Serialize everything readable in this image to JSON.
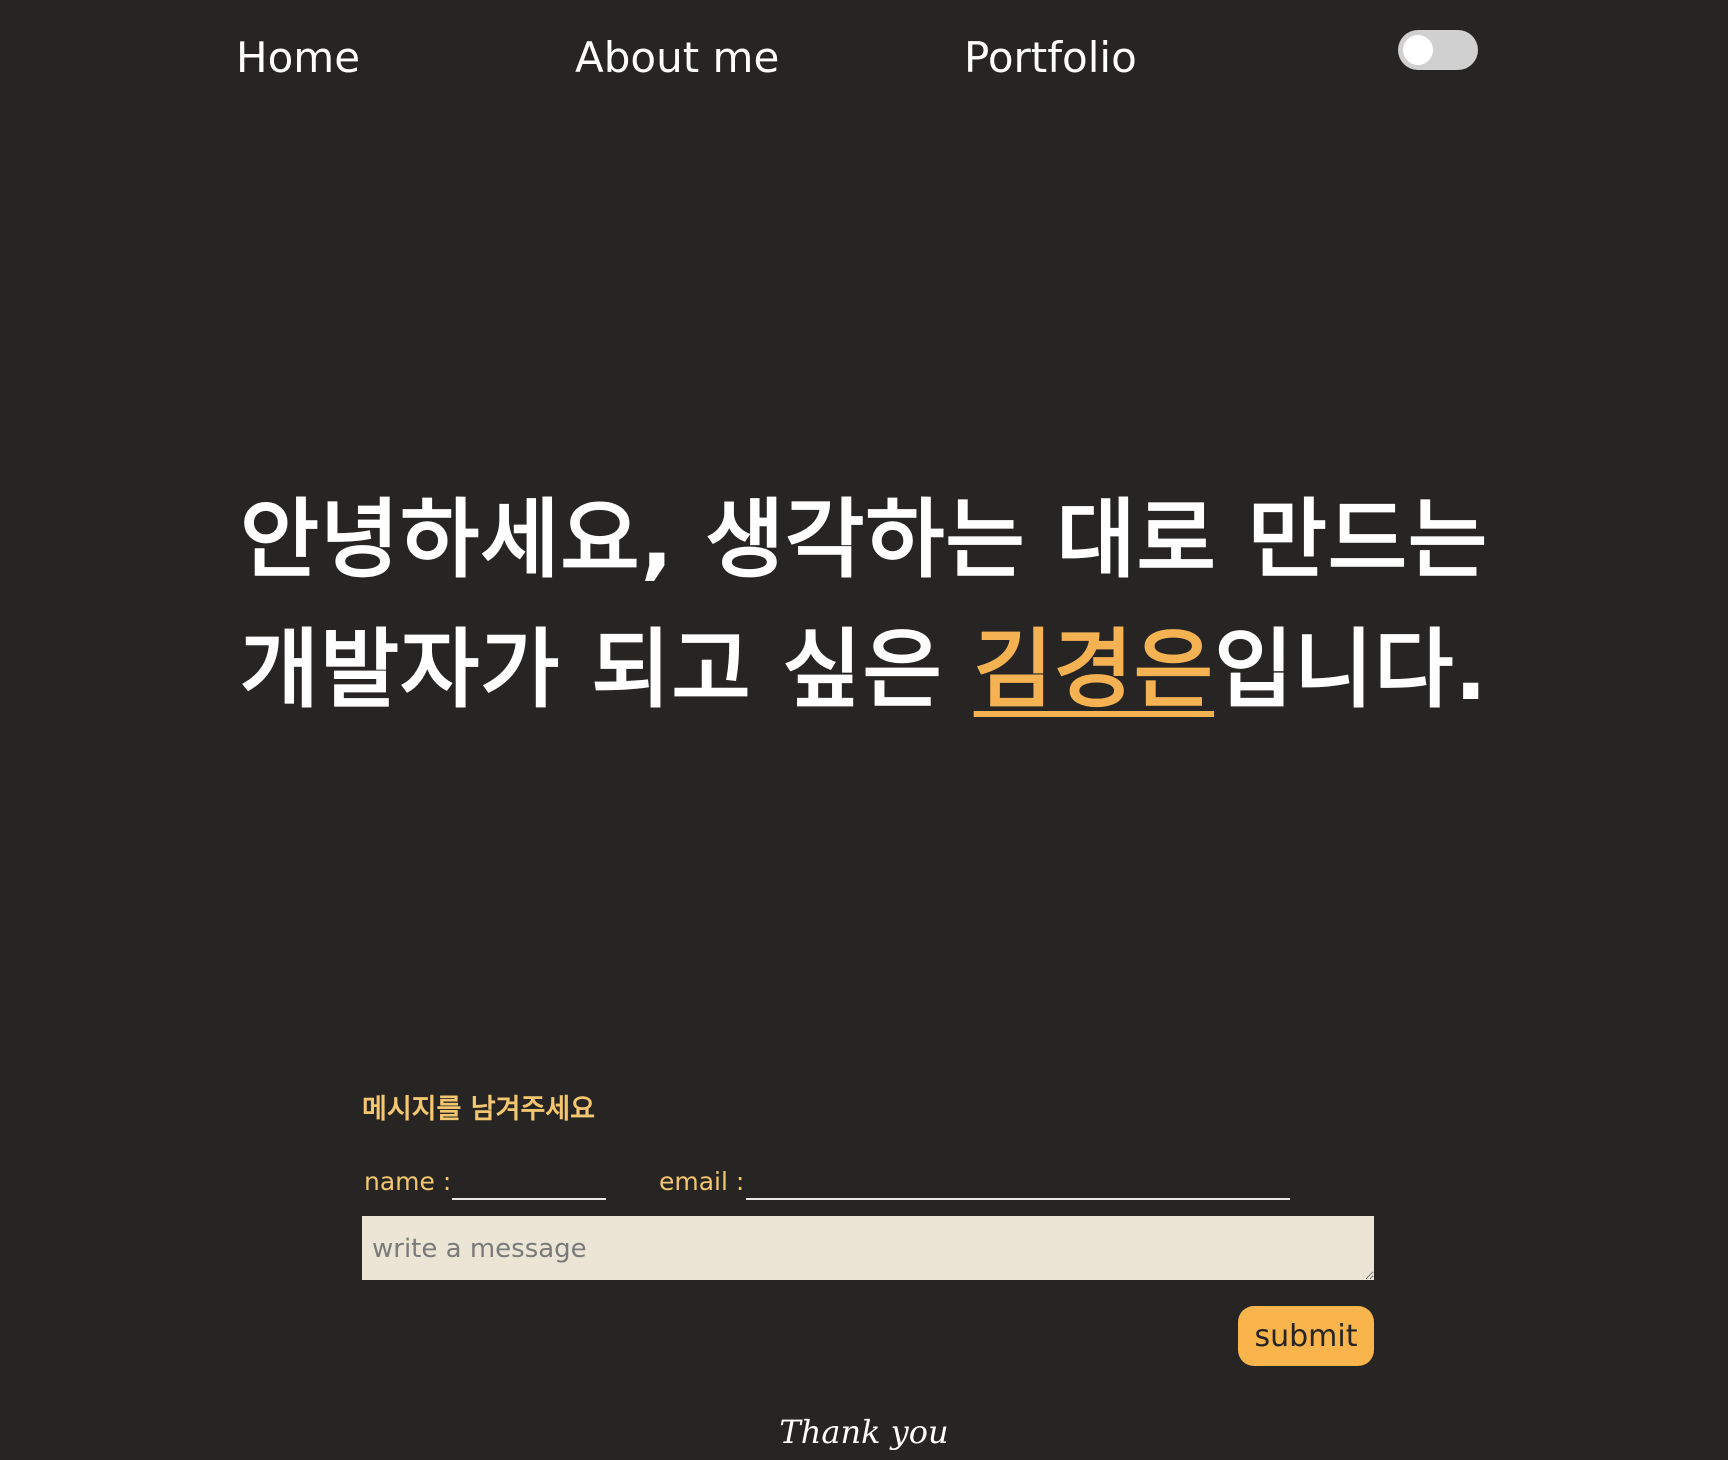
{
  "nav": {
    "items": [
      {
        "label": "Home"
      },
      {
        "label": "About me"
      },
      {
        "label": "Portfolio"
      }
    ],
    "theme_toggle": {
      "state": "off"
    }
  },
  "hero": {
    "line1": "안녕하세요, 생각하는 대로 만드는",
    "line2_before": "개발자가 되고 싶은 ",
    "name": "김경은",
    "line2_after": "입니다."
  },
  "contact": {
    "title": "메시지를 남겨주세요",
    "name_label": "name :",
    "name_value": "",
    "email_label": "email :",
    "email_value": "",
    "message_placeholder": "write a message",
    "submit_label": "submit"
  },
  "footer": {
    "text": "Thank you"
  },
  "colors": {
    "background": "#262523",
    "accent": "#f4b253",
    "label": "#f4c66f",
    "message_bg": "#ece5d6",
    "button": "#f9b44c"
  }
}
